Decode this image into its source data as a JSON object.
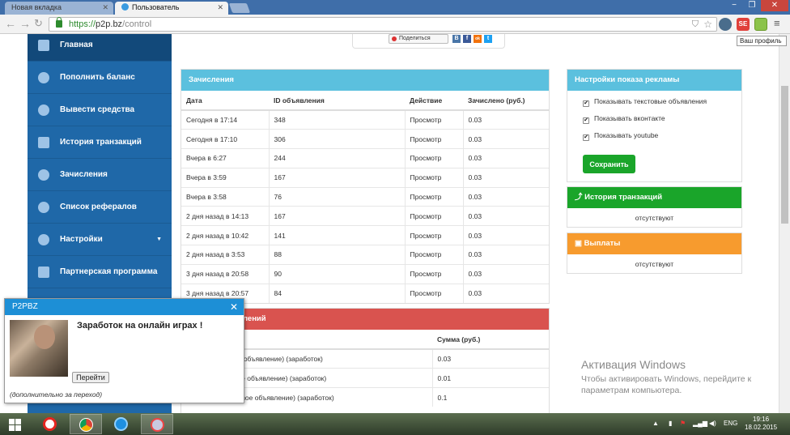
{
  "browser": {
    "tabs": [
      {
        "label": "Новая вкладка",
        "active": false
      },
      {
        "label": "Пользователь",
        "active": true
      }
    ],
    "url_scheme": "https://",
    "url_host": "p2p.bz",
    "url_path": "/control",
    "tooltip": "Ваш профиль",
    "window_controls": {
      "minimize": "−",
      "restore": "❐",
      "close": "✕"
    },
    "extensions": [
      "shield-icon",
      "star-icon",
      "extension-icon",
      "extension-icon",
      "se-icon",
      "profile-icon",
      "menu-icon"
    ]
  },
  "sidebar": {
    "items": [
      {
        "label": "Главная",
        "icon": "monitor-icon"
      },
      {
        "label": "Пополнить баланс",
        "icon": "money-icon"
      },
      {
        "label": "Вывести средства",
        "icon": "money-icon"
      },
      {
        "label": "История транзакций",
        "icon": "list-icon"
      },
      {
        "label": "Зачисления",
        "icon": "money-icon"
      },
      {
        "label": "Список рефералов",
        "icon": "users-icon"
      },
      {
        "label": "Настройки",
        "icon": "cogs-icon"
      },
      {
        "label": "Партнерская программа",
        "icon": "list-icon"
      }
    ]
  },
  "social": {
    "share_label": "Поделиться",
    "networks": [
      "В",
      "f",
      "ok",
      "t"
    ]
  },
  "credits": {
    "title": "Зачисления",
    "columns": [
      "Дата",
      "ID объявления",
      "Действие",
      "Зачислено (руб.)"
    ],
    "rows": [
      [
        "Сегодня в 17:14",
        "348",
        "Просмотр",
        "0.03"
      ],
      [
        "Сегодня в 17:10",
        "306",
        "Просмотр",
        "0.03"
      ],
      [
        "Вчера в 6:27",
        "244",
        "Просмотр",
        "0.03"
      ],
      [
        "Вчера в 3:59",
        "167",
        "Просмотр",
        "0.03"
      ],
      [
        "Вчера в 3:58",
        "76",
        "Просмотр",
        "0.03"
      ],
      [
        "2 дня назад в 14:13",
        "167",
        "Просмотр",
        "0.03"
      ],
      [
        "2 дня назад в 10:42",
        "141",
        "Просмотр",
        "0.03"
      ],
      [
        "2 дня назад в 3:53",
        "88",
        "Просмотр",
        "0.03"
      ],
      [
        "3 дня назад в 20:58",
        "90",
        "Просмотр",
        "0.03"
      ],
      [
        "3 дня назад в 20:57",
        "84",
        "Просмотр",
        "0.03"
      ]
    ]
  },
  "earnings": {
    "title_fragment": "лений",
    "column_amount": "Сумма (руб.)",
    "rows": [
      [
        "ое объявление) (заработок)",
        "0.03"
      ],
      [
        "вое объявление) (заработок)",
        "0.01"
      ],
      [
        "ровое объявление) (заработок)",
        "0.1"
      ]
    ]
  },
  "ad_settings": {
    "title": "Настройки показа рекламы",
    "options": [
      {
        "label": "Показывать текстовые объявления",
        "checked": true
      },
      {
        "label": "Показывать вконтакте",
        "checked": true
      },
      {
        "label": "Показывать youtube",
        "checked": true
      }
    ],
    "save_label": "Сохранить"
  },
  "history_panel": {
    "title": "История транзакций",
    "empty": "отсутствуют"
  },
  "payouts_panel": {
    "title": "Выплаты",
    "empty": "отсутствуют"
  },
  "popup": {
    "header": "P2PBZ",
    "close": "✕",
    "headline": "Заработок на онлайн играх !",
    "button": "Перейти",
    "note": "(дополнительно за переход)"
  },
  "watermark": {
    "title": "Активация Windows",
    "line1": "Чтобы активировать Windows, перейдите к",
    "line2": "параметрам компьютера."
  },
  "taskbar": {
    "lang": "ENG",
    "time": "19:16",
    "date": "18.02.2015"
  },
  "colors": {
    "sidebar": "#1f68a8",
    "sidebar_active": "#12497a",
    "info": "#5bc0de",
    "danger": "#d9534f",
    "success": "#1aa52a",
    "warning": "#f79b2e",
    "popup_header": "#1d8fd6"
  }
}
